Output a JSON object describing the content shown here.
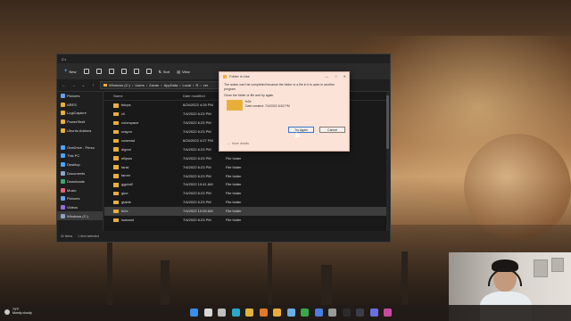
{
  "explorer": {
    "tab_title": "C:\\",
    "toolbar": {
      "new_label": "New",
      "sort_label": "Sort",
      "view_label": "View"
    },
    "address": {
      "segments": [
        "Windows (C:)",
        "Users",
        "Zavan",
        "AppData",
        "Local",
        "R",
        "ver"
      ]
    },
    "sidebar": {
      "items": [
        {
          "label": "Pictures",
          "color": "#6aa0e8"
        },
        {
          "label": "ARES",
          "color": "#e8b03a"
        },
        {
          "label": "LogiCapture",
          "color": "#e8b03a"
        },
        {
          "label": "PowerShell",
          "color": "#e8b03a"
        },
        {
          "label": "Ubuntu Addons",
          "color": "#e8b03a"
        },
        {
          "label": "",
          "color": "#1f1f1f"
        },
        {
          "label": "OneDrive - Perso",
          "color": "#4ea3ff"
        },
        {
          "label": "This PC",
          "color": "#4ea3ff"
        },
        {
          "label": "Desktop",
          "color": "#4ea3ff"
        },
        {
          "label": "Documents",
          "color": "#8aa4c8"
        },
        {
          "label": "Downloads",
          "color": "#3da86b"
        },
        {
          "label": "Music",
          "color": "#e0647a"
        },
        {
          "label": "Pictures",
          "color": "#6aa0e8"
        },
        {
          "label": "Videos",
          "color": "#9b6ae0"
        },
        {
          "label": "Windows (C:)",
          "color": "#8aa4c8"
        }
      ]
    },
    "columns": {
      "name": "Name",
      "date": "Date modified",
      "type": "Type"
    },
    "files": [
      {
        "name": "bitops",
        "date": "6/24/2022 4:26 PM",
        "type": "File folder"
      },
      {
        "name": "cli",
        "date": "7/4/2022 6:23 PM",
        "type": "File folder"
      },
      {
        "name": "colorspace",
        "date": "7/4/2022 6:23 PM",
        "type": "File folder"
      },
      {
        "name": "crayon",
        "date": "7/4/2022 6:23 PM",
        "type": "File folder"
      },
      {
        "name": "cowread",
        "date": "6/24/2022 4:27 PM",
        "type": "File folder"
      },
      {
        "name": "digest",
        "date": "7/4/2022 6:23 PM",
        "type": "File folder"
      },
      {
        "name": "ellipsis",
        "date": "7/4/2022 6:23 PM",
        "type": "File folder"
      },
      {
        "name": "fansi",
        "date": "7/4/2022 6:23 PM",
        "type": "File folder"
      },
      {
        "name": "farver",
        "date": "7/4/2022 6:23 PM",
        "type": "File folder"
      },
      {
        "name": "ggplot2",
        "date": "7/4/2022 10:41 AM",
        "type": "File folder"
      },
      {
        "name": "glue",
        "date": "7/4/2022 6:23 PM",
        "type": "File folder"
      },
      {
        "name": "gtable",
        "date": "7/4/2022 6:23 PM",
        "type": "File folder"
      },
      {
        "name": "fs2e",
        "date": "7/4/2022 10:59 AM",
        "type": "File folder",
        "selected": true
      },
      {
        "name": "isoband",
        "date": "7/4/2022 6:23 PM",
        "type": "File folder"
      }
    ],
    "status": {
      "count": "31 items",
      "selected": "1 item selected"
    }
  },
  "dialog": {
    "title": "Folder In Use",
    "message": "The action can't be completed because the folder or a file in it is open in another program",
    "instruction": "Close the folder or file and try again.",
    "file_name": "fs2e",
    "file_date": "Date created: 7/4/2022 6:52 PM",
    "try_again": "Try Again",
    "cancel": "Cancel",
    "more_details": "More details",
    "controls": {
      "minimize": "—",
      "maximize": "□",
      "close": "✕"
    }
  },
  "taskbar": {
    "weather_temp": "79°F",
    "weather_desc": "Mostly cloudy",
    "apps": [
      {
        "name": "windows",
        "color": "#3a8ee8"
      },
      {
        "name": "search",
        "color": "#d8d8d8"
      },
      {
        "name": "taskview",
        "color": "#bfbfbf"
      },
      {
        "name": "edge",
        "color": "#2aa8c8"
      },
      {
        "name": "chrome",
        "color": "#e0b43a"
      },
      {
        "name": "firefox",
        "color": "#e07a2a"
      },
      {
        "name": "explorer",
        "color": "#e8b03a"
      },
      {
        "name": "photos",
        "color": "#6ab0e8"
      },
      {
        "name": "xbox",
        "color": "#3aa84a"
      },
      {
        "name": "store",
        "color": "#4a7ee0"
      },
      {
        "name": "settings",
        "color": "#9a9a9a"
      },
      {
        "name": "terminal",
        "color": "#2b2b2b"
      },
      {
        "name": "obs",
        "color": "#3b3b4b"
      },
      {
        "name": "discord",
        "color": "#6a70e0"
      },
      {
        "name": "app15",
        "color": "#c84aa0"
      }
    ]
  }
}
